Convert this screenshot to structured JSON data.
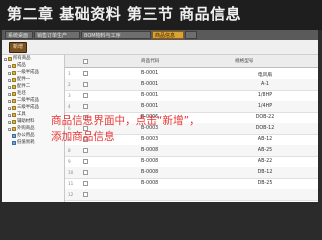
{
  "header": {
    "title": "第二章 基础资料 第三节 商品信息"
  },
  "tabs": [
    {
      "label": "系统桌面",
      "active": false
    },
    {
      "label": "销售订单生产",
      "active": false
    },
    {
      "label": "BOM物料与工序",
      "active": false
    },
    {
      "label": "商品信息",
      "active": true
    },
    {
      "label": "",
      "active": false
    }
  ],
  "toolbar": {
    "add_label": "新增"
  },
  "tree": {
    "root": "所有商品",
    "items": [
      {
        "label": "成品",
        "icon": "folder-icon"
      },
      {
        "label": "一级半成品",
        "icon": "folder-icon"
      },
      {
        "label": "配件一",
        "icon": "folder-icon"
      },
      {
        "label": "配件二",
        "icon": "folder-icon"
      },
      {
        "label": "毛坯",
        "icon": "folder-icon"
      },
      {
        "label": "二级半成品",
        "icon": "folder-icon"
      },
      {
        "label": "三级半成品",
        "icon": "folder-icon"
      },
      {
        "label": "工具",
        "icon": "folder-icon"
      },
      {
        "label": "辅助材料",
        "icon": "folder-icon"
      },
      {
        "label": "外购商品",
        "icon": "folder-icon"
      },
      {
        "label": "办公用品",
        "icon": "document-icon"
      },
      {
        "label": "低值易耗",
        "icon": "document-icon"
      }
    ]
  },
  "grid": {
    "columns": [
      "商品代码",
      "规格型号"
    ],
    "rows": [
      {
        "num": "1",
        "code": "B-0001",
        "spec": "电风扇"
      },
      {
        "num": "2",
        "code": "B-0001",
        "spec": "A-1"
      },
      {
        "num": "3",
        "code": "B-0001",
        "spec": "1/8HP"
      },
      {
        "num": "4",
        "code": "B-0001",
        "spec": "1/4HP"
      },
      {
        "num": "5",
        "code": "B-0006",
        "spec": "DOB-22"
      },
      {
        "num": "6",
        "code": "B-0003",
        "spec": "DOB-12"
      },
      {
        "num": "7",
        "code": "B-0003",
        "spec": "AB-12"
      },
      {
        "num": "8",
        "code": "B-0008",
        "spec": "AB-25"
      },
      {
        "num": "9",
        "code": "B-0008",
        "spec": "AB-22"
      },
      {
        "num": "10",
        "code": "B-0008",
        "spec": "DB-12"
      },
      {
        "num": "11",
        "code": "B-0008",
        "spec": "DB-25"
      },
      {
        "num": "12",
        "code": "",
        "spec": ""
      }
    ]
  },
  "annotation": {
    "line1": "商品信息界面中，点击“新增”，",
    "line2": "添加商品信息"
  }
}
